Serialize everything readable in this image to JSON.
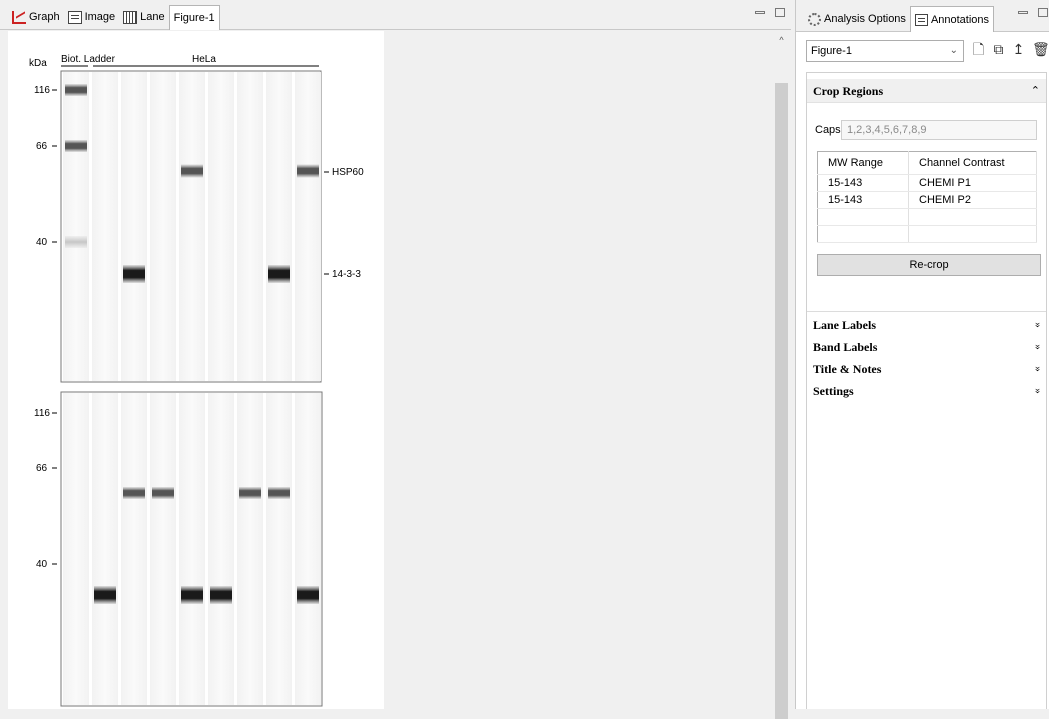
{
  "left_tabs": [
    {
      "label": "Graph",
      "icon": "graph-icon"
    },
    {
      "label": "Image",
      "icon": "image-icon"
    },
    {
      "label": "Lane",
      "icon": "lane-icon"
    },
    {
      "label": "Figure-1",
      "icon": ""
    }
  ],
  "right_tabs": [
    {
      "label": "Analysis Options",
      "icon": "gear-icon"
    },
    {
      "label": "Annotations",
      "icon": "annotations-icon"
    }
  ],
  "figure": {
    "kda_label": "kDa",
    "group_labels": [
      "Biot. Ladder",
      "HeLa"
    ],
    "panel1": {
      "mw_ticks": [
        "116",
        "66",
        "40"
      ],
      "band_annotations": [
        "HSP60",
        "14-3-3"
      ],
      "bands": [
        {
          "lane": 1,
          "kind": "ladder",
          "label": "116"
        },
        {
          "lane": 1,
          "kind": "ladder",
          "label": "66"
        },
        {
          "lane": 1,
          "kind": "ladder-faint",
          "label": "40"
        },
        {
          "lane": 3,
          "kind": "14-3-3"
        },
        {
          "lane": 5,
          "kind": "HSP60"
        },
        {
          "lane": 8,
          "kind": "14-3-3"
        },
        {
          "lane": 9,
          "kind": "HSP60"
        }
      ]
    },
    "panel2": {
      "mw_ticks": [
        "116",
        "66",
        "40"
      ],
      "bands": [
        {
          "lane": 2,
          "kind": "low"
        },
        {
          "lane": 3,
          "kind": "high"
        },
        {
          "lane": 4,
          "kind": "high"
        },
        {
          "lane": 5,
          "kind": "low"
        },
        {
          "lane": 6,
          "kind": "low"
        },
        {
          "lane": 7,
          "kind": "high"
        },
        {
          "lane": 8,
          "kind": "high"
        },
        {
          "lane": 9,
          "kind": "low"
        }
      ]
    }
  },
  "annotations": {
    "figure_select": "Figure-1",
    "crop_regions": {
      "title": "Crop Regions",
      "caps_label": "Caps",
      "caps_value": "1,2,3,4,5,6,7,8,9",
      "columns": [
        "MW Range",
        "Channel Contrast"
      ],
      "rows": [
        [
          "15-143",
          "CHEMI P1"
        ],
        [
          "15-143",
          "CHEMI P2"
        ],
        [
          "",
          ""
        ],
        [
          "",
          ""
        ]
      ],
      "recrop_label": "Re-crop"
    },
    "sections": [
      "Lane Labels",
      "Band Labels",
      "Title & Notes",
      "Settings"
    ]
  }
}
